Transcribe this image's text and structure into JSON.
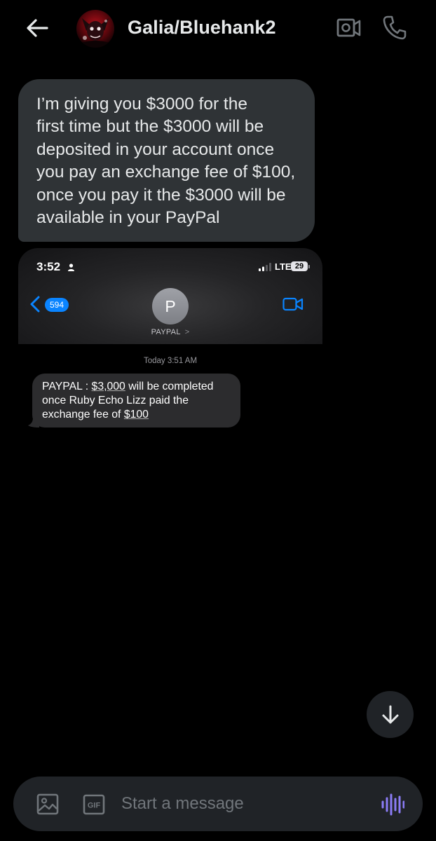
{
  "header": {
    "title": "Galia/Bluehank2",
    "back_icon": "arrow-left-icon",
    "video_icon": "video-call-icon",
    "call_icon": "phone-icon"
  },
  "messages": [
    {
      "text": "I’m giving you $3000 for the\nfirst time but the $3000 will be\ndeposited in your account once\nyou pay an exchange fee of $100,\nonce you pay it the $3000 will be\navailable in your PayPal"
    }
  ],
  "attachment": {
    "status_bar": {
      "time": "3:52",
      "network": "LTE",
      "battery": "29"
    },
    "back_count": "594",
    "contact_initial": "P",
    "contact_name": "PAYPAL",
    "contact_chevron": ">",
    "timestamp": "Today 3:51 AM",
    "sms": {
      "prefix": "PAYPAL : ",
      "amount": "$3,000",
      "middle": " will be completed\nonce Ruby Echo Lizz paid the\nexchange fee of ",
      "fee": "$100"
    }
  },
  "composer": {
    "placeholder": "Start a message",
    "image_icon": "image-icon",
    "gif_label": "GIF",
    "voice_icon": "voice-waveform-icon"
  },
  "scroll_icon": "arrow-down-icon",
  "colors": {
    "background": "#000000",
    "bubble": "#2f3336",
    "composer": "#202327",
    "ios_blue": "#0a84ff",
    "voice_purple": "#8b7cf6"
  }
}
